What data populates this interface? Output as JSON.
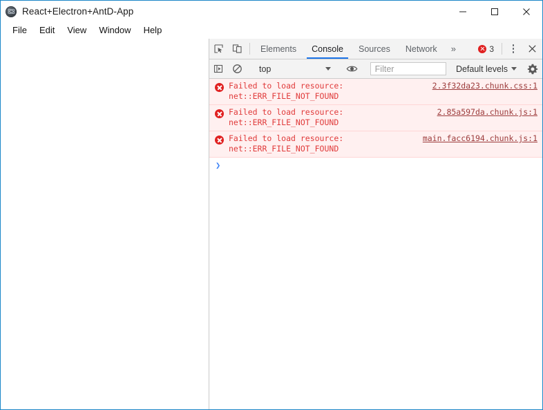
{
  "window": {
    "title": "React+Electron+AntD-App",
    "app_icon": "electron-logo-icon",
    "controls": {
      "minimize": "minimize-icon",
      "maximize": "maximize-icon",
      "close": "close-icon"
    }
  },
  "menubar": {
    "items": [
      {
        "label": "File"
      },
      {
        "label": "Edit"
      },
      {
        "label": "View"
      },
      {
        "label": "Window"
      },
      {
        "label": "Help"
      }
    ]
  },
  "devtools": {
    "tabbar": {
      "inspect_icon": "inspect-element-icon",
      "device_icon": "device-toolbar-icon",
      "tabs": [
        {
          "label": "Elements",
          "active": false
        },
        {
          "label": "Console",
          "active": true
        },
        {
          "label": "Sources",
          "active": false
        },
        {
          "label": "Network",
          "active": false
        }
      ],
      "overflow_label": "»",
      "error_count": "3",
      "error_icon": "error-circle-icon",
      "menu_icon": "kebab-menu-icon",
      "close_icon": "close-icon",
      "active_underline_color": "#1a73e8"
    },
    "filterbar": {
      "sidebar_toggle_icon": "console-sidebar-icon",
      "clear_icon": "clear-console-icon",
      "context_value": "top",
      "eye_icon": "live-expression-icon",
      "filter_placeholder": "Filter",
      "filter_value": "",
      "levels_value": "Default levels",
      "settings_icon": "gear-icon"
    },
    "console": {
      "messages": [
        {
          "level": "error",
          "text": "Failed to load resource:\nnet::ERR_FILE_NOT_FOUND",
          "source": "2.3f32da23.chunk.css:1"
        },
        {
          "level": "error",
          "text": "Failed to load resource:\nnet::ERR_FILE_NOT_FOUND",
          "source": "2.85a597da.chunk.js:1"
        },
        {
          "level": "error",
          "text": "Failed to load resource:\nnet::ERR_FILE_NOT_FOUND",
          "source": "main.facc6194.chunk.js:1"
        }
      ],
      "prompt_symbol": "❯",
      "error_row_bg": "#fff0f0",
      "error_text_color": "#e03a3a"
    }
  },
  "app_viewport": {
    "content": ""
  }
}
